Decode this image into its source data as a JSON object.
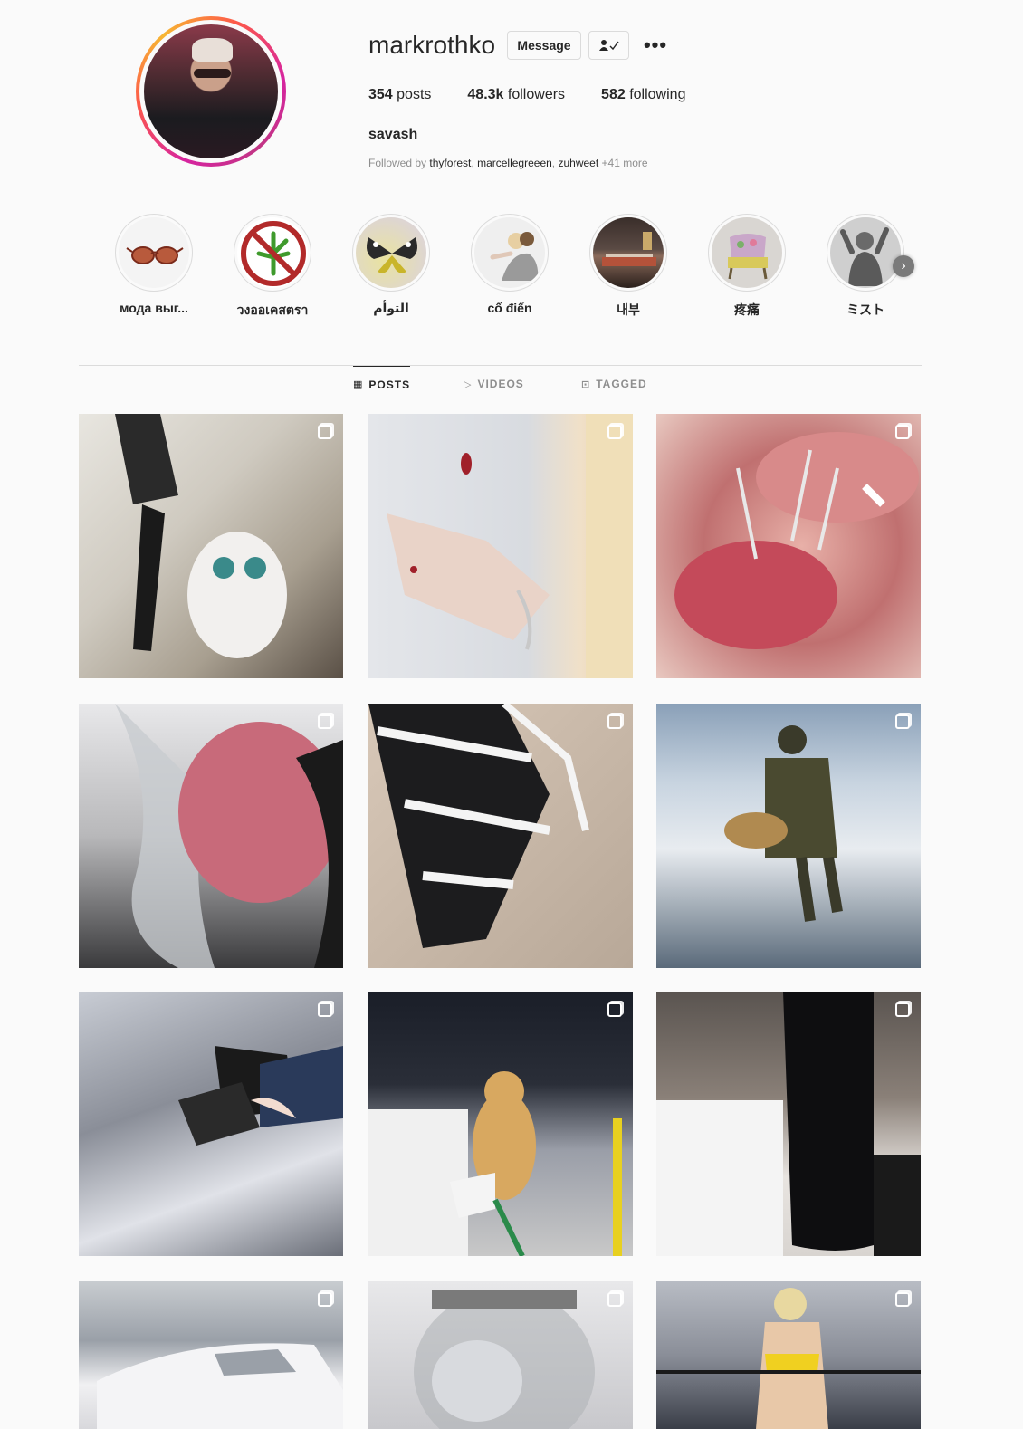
{
  "profile": {
    "username": "markrothko",
    "message_label": "Message",
    "follow_icon": "person-check-icon",
    "more_label": "•••",
    "stats": [
      {
        "count": "354",
        "label": "posts"
      },
      {
        "count": "48.3k",
        "label": "followers"
      },
      {
        "count": "582",
        "label": "following"
      }
    ],
    "full_name": "savash",
    "followed_by_prefix": "Followed by",
    "followed_by": [
      "thyforest",
      "marcellegreeen",
      "zuhweet"
    ],
    "followed_by_more": "+41 more"
  },
  "highlights": [
    {
      "label": "мода выг...",
      "icon": "sunglasses-icon"
    },
    {
      "label": "วงออเคสตรา",
      "icon": "no-cannabis-icon"
    },
    {
      "label": "التوأم",
      "icon": "butterfly-icon"
    },
    {
      "label": "cổ điển",
      "icon": "people-icon"
    },
    {
      "label": "내부",
      "icon": "interior-icon"
    },
    {
      "label": "疼痛",
      "icon": "chair-icon"
    },
    {
      "label": "ミスト",
      "icon": "statue-icon"
    }
  ],
  "tabs": [
    {
      "label": "POSTS",
      "icon": "grid-icon",
      "active": true
    },
    {
      "label": "VIDEOS",
      "icon": "play-icon",
      "active": false
    },
    {
      "label": "TAGGED",
      "icon": "tag-icon",
      "active": false
    }
  ],
  "colors": {
    "text": "#262626",
    "muted": "#8e8e8e",
    "border": "#dbdbdb",
    "background": "#fafafa"
  }
}
